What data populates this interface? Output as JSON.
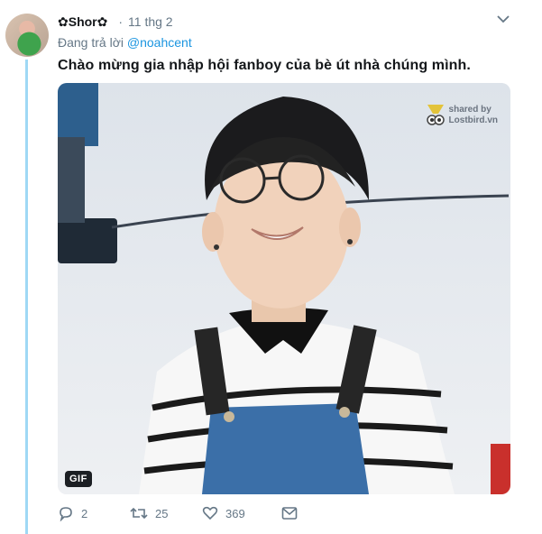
{
  "tweet": {
    "author": "✿Shor✿",
    "time": "11 thg 2",
    "replying_prefix": "Đang trả lời",
    "replying_to": "@noahcent",
    "text": "Chào mừng gia nhập hội fanboy của bè út nhà chúng mình.",
    "media": {
      "badge": "GIF",
      "watermark_line1": "shared by",
      "watermark_line2": "Lostbird.vn"
    },
    "actions": {
      "reply_count": "2",
      "retweet_count": "25",
      "like_count": "369"
    }
  },
  "colors": {
    "link": "#1b95e0",
    "thread_line": "#9fd8f5",
    "muted": "#657786"
  },
  "icons": [
    "chevron-down-icon",
    "reply-icon",
    "retweet-icon",
    "like-icon",
    "message-icon"
  ]
}
